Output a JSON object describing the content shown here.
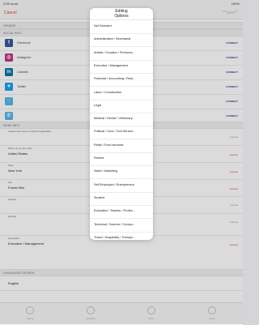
{
  "status_bar": {
    "time": "3:25 cs.ek",
    "battery": "100%"
  },
  "nav": {
    "cancel": "Cancel",
    "title": "Editing",
    "save": "**Save**"
  },
  "sections": {
    "gender": "GENDER",
    "social": "SOCIAL INFO",
    "more": "MORE INFO",
    "languages": "LANGUAGES SPOKEN"
  },
  "social_rows": [
    {
      "label": "Facebook",
      "action": "CONNECT",
      "icon": "facebook-icon",
      "color": "#3b5998"
    },
    {
      "label": "Instagram",
      "action": "CONNECT",
      "icon": "instagram-icon",
      "color": "#c13584"
    },
    {
      "label": "LinkedIn",
      "action": "CONNECT",
      "icon": "linkedin-icon",
      "color": "#0e76a8"
    },
    {
      "label": "Twitter",
      "action": "CONNECT",
      "icon": "twitter-icon",
      "color": "#1da1f2"
    },
    {
      "label": "",
      "action": "CONNECT",
      "icon": "globe-icon",
      "color": "#5bb5e8"
    },
    {
      "label": "",
      "action": "CONNECT",
      "icon": "phone-icon",
      "color": "#5bb5e8"
    }
  ],
  "fields": [
    {
      "label": "Closest metro area in United (if applicable)",
      "value": "",
      "tag": "optional"
    },
    {
      "label": "Where do you live now?",
      "value": "United States",
      "tag": "required"
    },
    {
      "label": "State",
      "value": "New York",
      "tag": "required"
    },
    {
      "label": "City",
      "value": "Forest Hills",
      "tag": "required"
    },
    {
      "label": "Industry",
      "value": "",
      "tag": "optional"
    },
    {
      "label": "Zipcode",
      "value": "",
      "tag": "optional"
    },
    {
      "label": "Occupation",
      "value": "Executive / Management",
      "tag": "required"
    }
  ],
  "language": "English",
  "tabs": [
    "Dating",
    "Activities",
    "Inbox",
    "Store"
  ],
  "picker": {
    "title": "Editing",
    "subtitle": "Options",
    "options": [
      "Not Selected",
      "Administrative / Secretarial",
      "Artistic / Creative / Performa...",
      "Executive / Management",
      "Financial / Accounting / Real...",
      "Labor / Construction",
      "Legal",
      "Medical / Dental / Veterinary...",
      "Political / Govt / Civil Service...",
      "Retail / Food services",
      "Retired",
      "Sales / Marketing",
      "Self-Employed / Entrepreneur",
      "Student",
      "Education / Teacher / Profes...",
      "Technical / Science / Compu...",
      "Travel / Hospitality / Transpo..."
    ]
  },
  "colors": {
    "accent": "#d3443a",
    "connect": "#3a3a8a"
  }
}
